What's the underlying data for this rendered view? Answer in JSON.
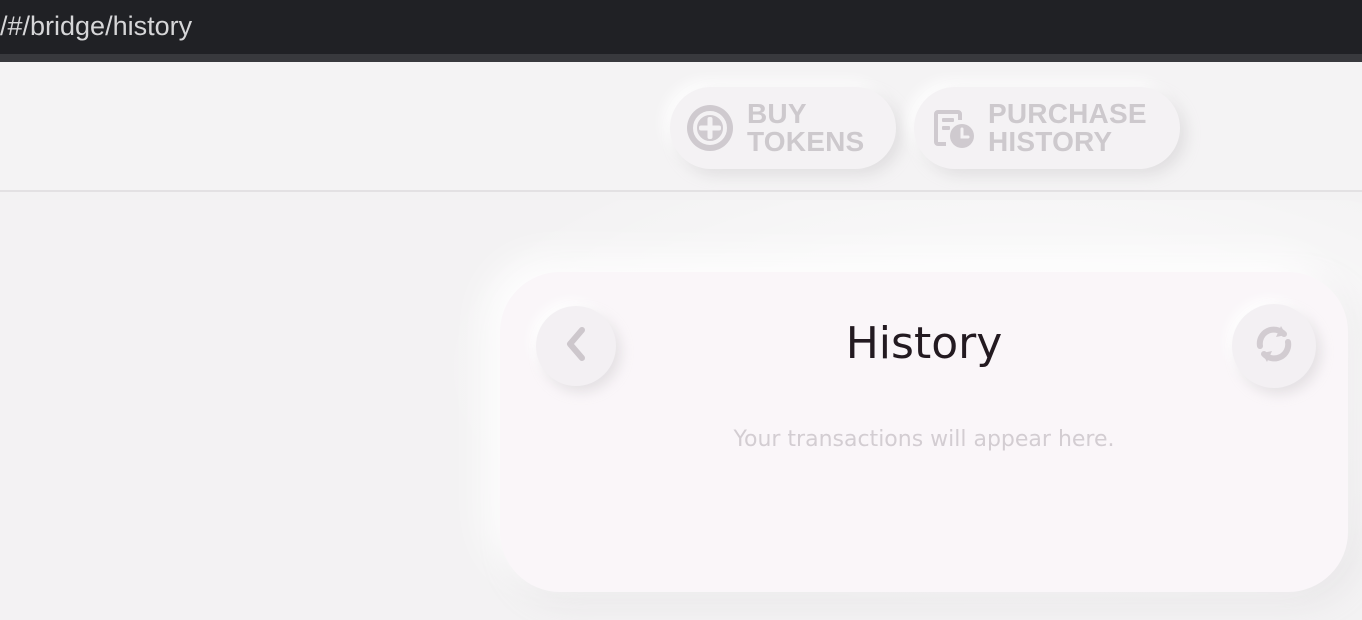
{
  "browser": {
    "url": "/#/bridge/history"
  },
  "header": {
    "buy_tokens": {
      "line1": "BUY",
      "line2": "TOKENS",
      "icon": "plus-circle-icon"
    },
    "purchase_history": {
      "line1": "PURCHASE",
      "line2": "HISTORY",
      "icon": "receipt-clock-icon"
    }
  },
  "history_card": {
    "title": "History",
    "empty_message": "Your transactions will appear here.",
    "back_icon": "chevron-left-icon",
    "refresh_icon": "refresh-icon"
  },
  "colors": {
    "background": "#f3f2f3",
    "card": "#faf6f9",
    "muted_text": "#cdc9cd",
    "title_text": "#231a21"
  }
}
